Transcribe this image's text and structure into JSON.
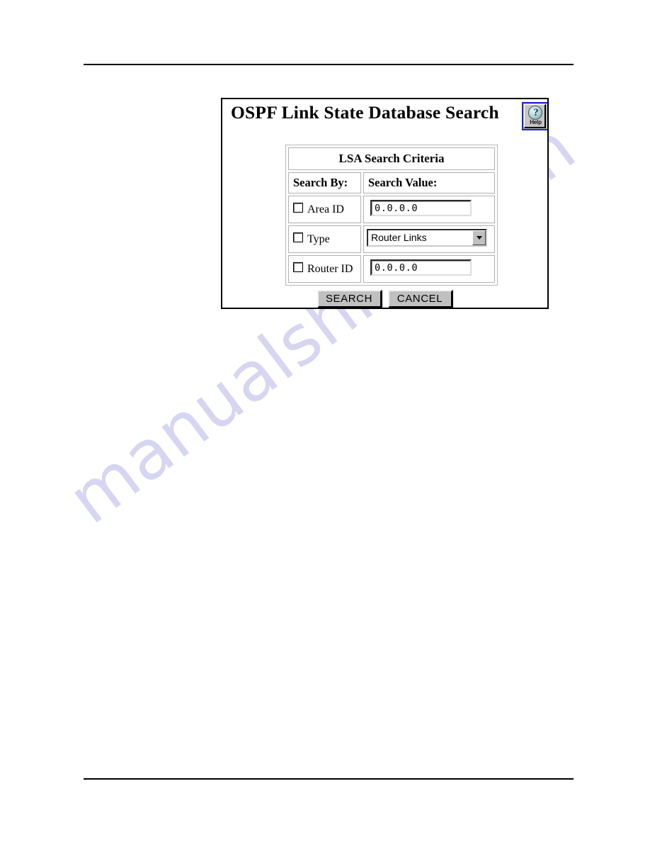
{
  "page": {
    "rule_top": "",
    "rule_bottom": ""
  },
  "watermark": {
    "text": "manualshive.com",
    "color": "#c9c9ef"
  },
  "dialog": {
    "title": "OSPF Link State Database Search",
    "help_button": {
      "icon": "question-mark-circle-icon",
      "label": "Help",
      "border_color": "#2222cc"
    },
    "table": {
      "caption": "LSA Search Criteria",
      "headers": {
        "search_by": "Search By:",
        "search_value": "Search Value:"
      },
      "rows": [
        {
          "label": "Area ID",
          "checkbox_checked": false,
          "control": "text",
          "value": "0.0.0.0"
        },
        {
          "label": "Type",
          "checkbox_checked": false,
          "control": "select",
          "value": "Router Links"
        },
        {
          "label": "Router ID",
          "checkbox_checked": false,
          "control": "text",
          "value": "0.0.0.0"
        }
      ]
    },
    "buttons": {
      "search": "SEARCH",
      "cancel": "CANCEL"
    }
  }
}
